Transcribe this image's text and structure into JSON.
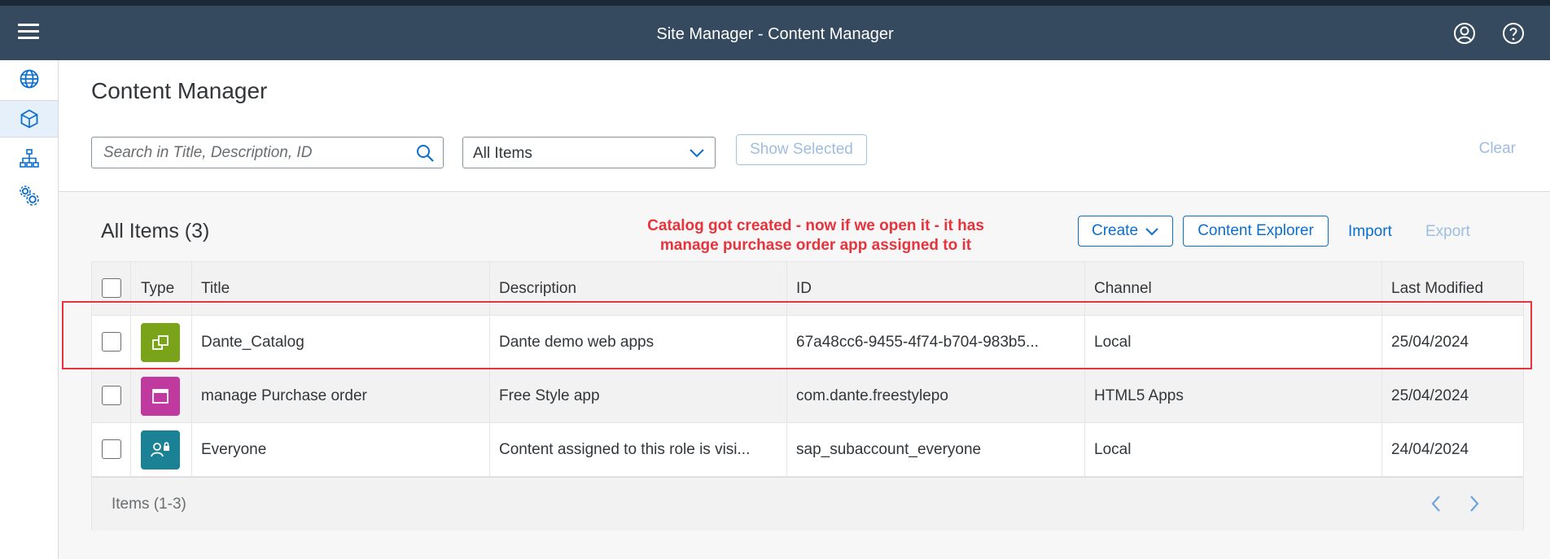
{
  "shell": {
    "title": "Site Manager - Content Manager"
  },
  "page": {
    "title": "Content Manager",
    "search_placeholder": "Search in Title, Description, ID",
    "filter_value": "All Items",
    "show_selected": "Show Selected",
    "clear": "Clear"
  },
  "table": {
    "title": "All Items (3)",
    "annotation_line1": "Catalog got created - now if we open it - it has",
    "annotation_line2": "manage purchase order app assigned to it",
    "create": "Create",
    "content_explorer": "Content Explorer",
    "import": "Import",
    "export": "Export",
    "columns": {
      "type": "Type",
      "title": "Title",
      "description": "Description",
      "id": "ID",
      "channel": "Channel",
      "last_modified": "Last Modified"
    },
    "rows": [
      {
        "title": "Dante_Catalog",
        "description": "Dante demo web apps",
        "id": "67a48cc6-9455-4f74-b704-983b5...",
        "channel": "Local",
        "last_modified": "25/04/2024",
        "icon": "catalog-icon",
        "color": "#7ba31a"
      },
      {
        "title": "manage Purchase order",
        "description": "Free Style app",
        "id": "com.dante.freestylepo",
        "channel": "HTML5 Apps",
        "last_modified": "25/04/2024",
        "icon": "app-window-icon",
        "color": "#c0399f"
      },
      {
        "title": "Everyone",
        "description": "Content assigned to this role is visi...",
        "id": "sap_subaccount_everyone",
        "channel": "Local",
        "last_modified": "24/04/2024",
        "icon": "role-icon",
        "color": "#1a8294"
      }
    ],
    "footer": "Items (1-3)"
  }
}
